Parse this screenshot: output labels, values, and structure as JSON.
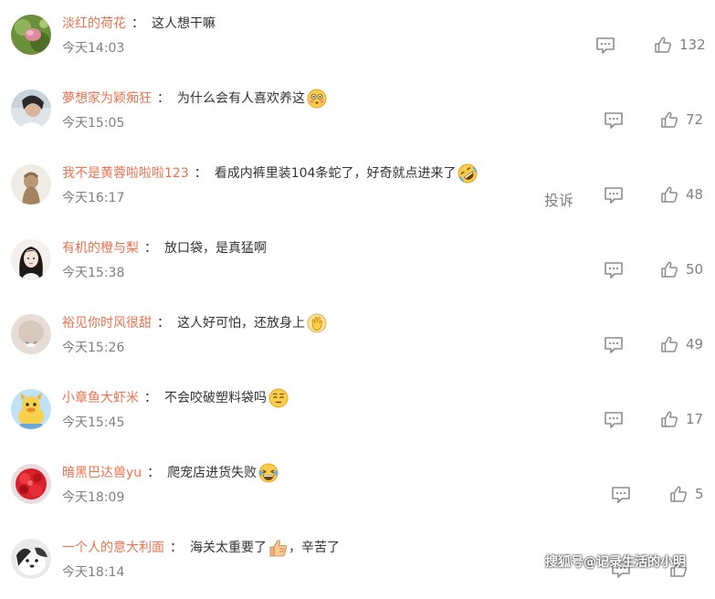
{
  "comments": [
    {
      "username": "淡红的荷花",
      "colon": "：",
      "text": "这人想干嘛",
      "emoji": "",
      "text_after": "",
      "time": "今天14:03",
      "likes": "132",
      "report": ""
    },
    {
      "username": "夢想家为颖痴狂",
      "colon": "：",
      "text": "为什么会有人喜欢养这",
      "emoji": "flushed-emoji",
      "text_after": "",
      "time": "今天15:05",
      "likes": "72",
      "report": ""
    },
    {
      "username": "我不是黄蓉啦啦啦123",
      "colon": "：",
      "text": "看成内裤里装104条蛇了，好奇就点进来了",
      "emoji": "rolling-laugh-emoji",
      "text_after": "",
      "time": "今天16:17",
      "likes": "48",
      "report": "投诉"
    },
    {
      "username": "有机的橙与梨",
      "colon": "：",
      "text": "放口袋，是真猛啊",
      "emoji": "",
      "text_after": "",
      "time": "今天15:38",
      "likes": "50",
      "report": ""
    },
    {
      "username": "裕见你时风很甜",
      "colon": "：",
      "text": "这人好可怕，还放身上",
      "emoji": "clap-emoji",
      "text_after": "",
      "time": "今天15:26",
      "likes": "49",
      "report": ""
    },
    {
      "username": "小章鱼大虾米",
      "colon": "：",
      "text": "不会咬破塑料袋吗",
      "emoji": "thinking-emoji",
      "text_after": "",
      "time": "今天15:45",
      "likes": "17",
      "report": ""
    },
    {
      "username": "暗黑巴达兽yu",
      "colon": "：",
      "text": "爬宠店进货失败",
      "emoji": "laughing-tears-emoji",
      "text_after": "",
      "time": "今天18:09",
      "likes": "5",
      "report": ""
    },
    {
      "username": "一个人的意大利面",
      "colon": "：",
      "text": "海关太重要了",
      "emoji": "thumbs-up-emoji",
      "text_after": "，辛苦了",
      "time": "今天18:14",
      "likes": "",
      "report": ""
    }
  ],
  "watermark": "搜狐号@记录生活的小明",
  "colors": {
    "username": "#eb7350",
    "text": "#333333",
    "meta": "#808080",
    "icon": "#8c8c8c"
  }
}
